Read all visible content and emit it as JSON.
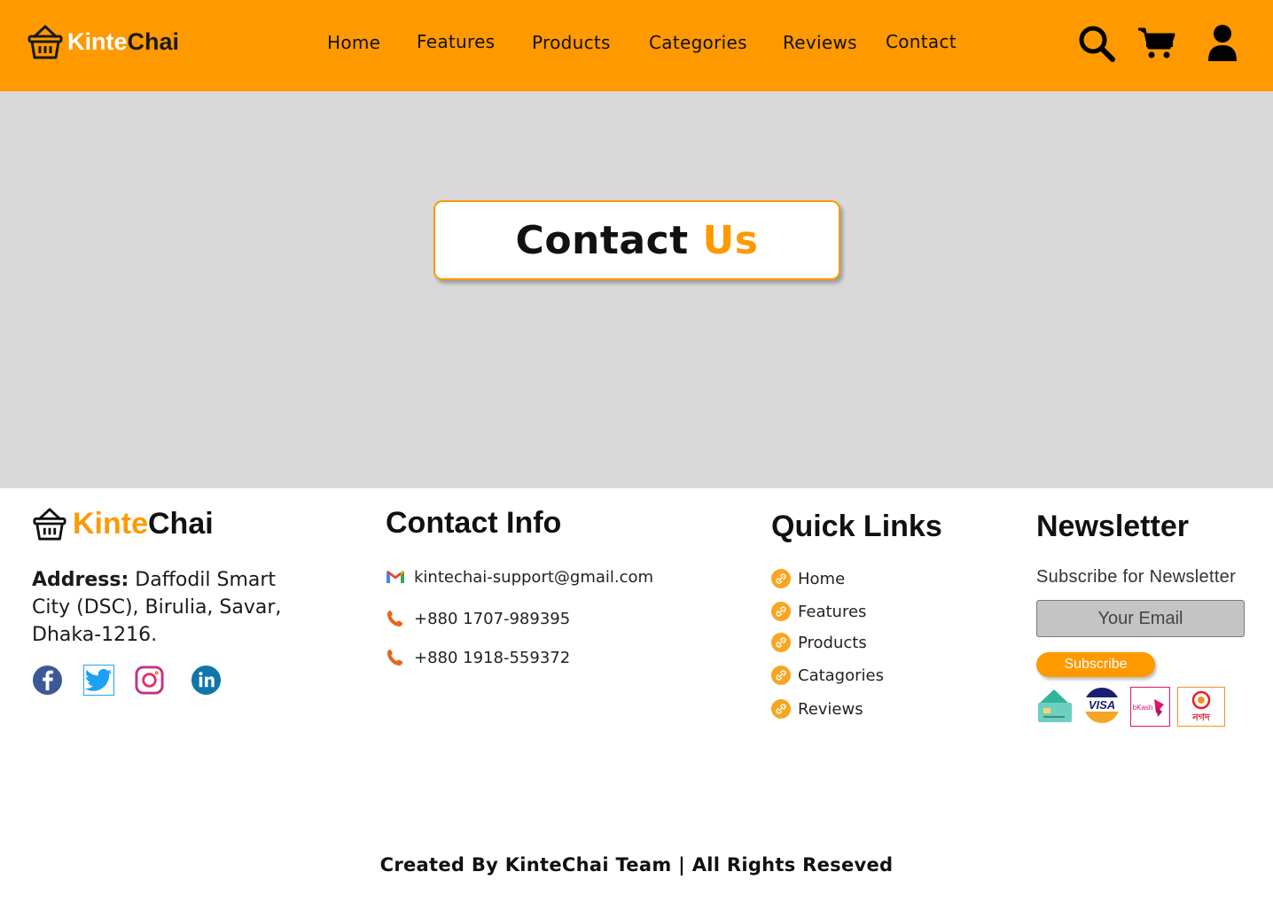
{
  "header": {
    "brand_part1": "Kinte",
    "brand_part2": "Chai",
    "nav": [
      "Home",
      "Features",
      "Products",
      "Categories",
      "Reviews",
      "Contact"
    ],
    "icons": [
      "search-icon",
      "cart-icon",
      "user-icon"
    ]
  },
  "hero": {
    "title_part1": "Contact",
    "title_part2": "Us"
  },
  "footer": {
    "brand_part1": "Kinte",
    "brand_part2": "Chai",
    "address_label": "Address:",
    "address_text": "Daffodil Smart City (DSC), Birulia, Savar, Dhaka-1216.",
    "socials": [
      "facebook-icon",
      "twitter-icon",
      "instagram-icon",
      "linkedin-icon"
    ],
    "contact_info": {
      "title": "Contact Info",
      "email": "kintechai-support@gmail.com",
      "phone1": "+880 1707-989395",
      "phone2": "+880 1918-559372"
    },
    "quick_links": {
      "title": "Quick Links",
      "items": [
        "Home",
        "Features",
        "Products",
        "Catagories",
        "Reviews"
      ]
    },
    "newsletter": {
      "title": "Newsletter",
      "subtitle": "Subscribe for Newsletter",
      "placeholder": "Your Email",
      "button": "Subscribe",
      "payments": [
        "card-icon",
        "visa-icon",
        "bkash-icon",
        "nagad-icon"
      ],
      "visa_text": "VISA",
      "bkash_text": "bKash",
      "nagad_text": "নগদ"
    },
    "credit": "Created By KinteChai Team | All Rights Reseved"
  },
  "colors": {
    "accent": "#ff9900",
    "hero_bg": "#d9d9d9"
  }
}
